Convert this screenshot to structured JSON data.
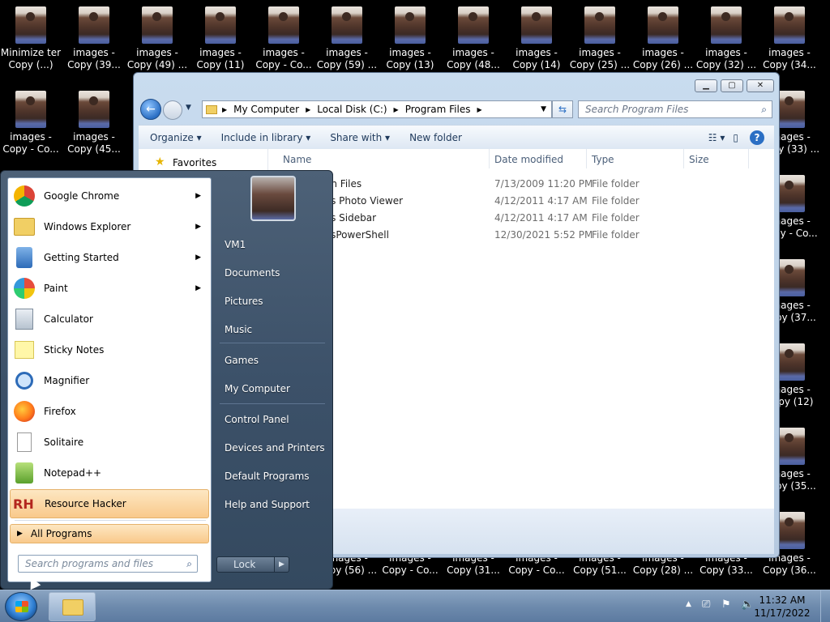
{
  "desktop": {
    "icons_top": [
      {
        "l1": "Minimize ter",
        "l2": "Copy (...)"
      },
      {
        "l1": "images -",
        "l2": "Copy (39..."
      },
      {
        "l1": "images -",
        "l2": "Copy (49) ..."
      },
      {
        "l1": "images -",
        "l2": "Copy (11)"
      },
      {
        "l1": "images -",
        "l2": "Copy - Co..."
      },
      {
        "l1": "images -",
        "l2": "Copy (59) ..."
      },
      {
        "l1": "images -",
        "l2": "Copy (13)"
      },
      {
        "l1": "images -",
        "l2": "Copy (48..."
      },
      {
        "l1": "images -",
        "l2": "Copy (14)"
      },
      {
        "l1": "images -",
        "l2": "Copy (25) ..."
      },
      {
        "l1": "images -",
        "l2": "Copy (26) ..."
      },
      {
        "l1": "images -",
        "l2": "Copy (32) ..."
      },
      {
        "l1": "images -",
        "l2": "Copy (34..."
      }
    ],
    "icons_second": [
      {
        "l1": "images -",
        "l2": "Copy - Co..."
      },
      {
        "l1": "images -",
        "l2": "Copy (45..."
      }
    ],
    "icons_right": [
      {
        "l1": "images -",
        "l2": "Copy (33) ..."
      },
      {
        "l1": "images -",
        "l2": "Copy - Co..."
      },
      {
        "l1": "images -",
        "l2": "Copy (37..."
      },
      {
        "l1": "images -",
        "l2": "Copy (12)"
      },
      {
        "l1": "images -",
        "l2": "Copy (35..."
      },
      {
        "l1": "images -",
        "l2": "Copy (36..."
      }
    ],
    "icons_bottom": [
      {
        "l1": "images -",
        "l2": "Copy (56) ..."
      },
      {
        "l1": "images -",
        "l2": "Copy - Co..."
      },
      {
        "l1": "images -",
        "l2": "Copy (31..."
      },
      {
        "l1": "images -",
        "l2": "Copy - Co..."
      },
      {
        "l1": "images -",
        "l2": "Copy (51..."
      },
      {
        "l1": "images -",
        "l2": "Copy (28) ..."
      },
      {
        "l1": "images -",
        "l2": "Copy (33..."
      }
    ]
  },
  "explorer": {
    "breadcrumb": [
      "My Computer",
      "Local Disk (C:)",
      "Program Files"
    ],
    "search_placeholder": "Search Program Files",
    "commands": [
      "Organize",
      "Include in library",
      "Share with",
      "New folder"
    ],
    "nav_favorites": "Favorites",
    "columns": {
      "name": "Name",
      "date": "Date modified",
      "type": "Type",
      "size": "Size"
    },
    "rows": [
      {
        "name": "en Files",
        "date": "7/13/2009 11:20 PM",
        "type": "File folder"
      },
      {
        "name": "vs Photo Viewer",
        "date": "4/12/2011 4:17 AM",
        "type": "File folder"
      },
      {
        "name": "vs Sidebar",
        "date": "4/12/2011 4:17 AM",
        "type": "File folder"
      },
      {
        "name": "vsPowerShell",
        "date": "12/30/2021 5:52 PM",
        "type": "File folder"
      }
    ]
  },
  "startmenu": {
    "programs": [
      {
        "label": "Google Chrome",
        "arrow": true
      },
      {
        "label": "Windows Explorer",
        "arrow": true
      },
      {
        "label": "Getting Started",
        "arrow": true
      },
      {
        "label": "Paint",
        "arrow": true
      },
      {
        "label": "Calculator",
        "arrow": false
      },
      {
        "label": "Sticky Notes",
        "arrow": false
      },
      {
        "label": "Magnifier",
        "arrow": false
      },
      {
        "label": "Firefox",
        "arrow": false
      },
      {
        "label": "Solitaire",
        "arrow": false
      },
      {
        "label": "Notepad++",
        "arrow": false
      },
      {
        "label": "Resource Hacker",
        "arrow": false
      }
    ],
    "all_programs": "All Programs",
    "search_placeholder": "Search programs and files",
    "right_items": [
      "VM1",
      "Documents",
      "Pictures",
      "Music",
      "Games",
      "My Computer",
      "Control Panel",
      "Devices and Printers",
      "Default Programs",
      "Help and Support"
    ],
    "lock_label": "Lock"
  },
  "taskbar": {
    "time": "11:32 AM",
    "date": "11/17/2022"
  }
}
